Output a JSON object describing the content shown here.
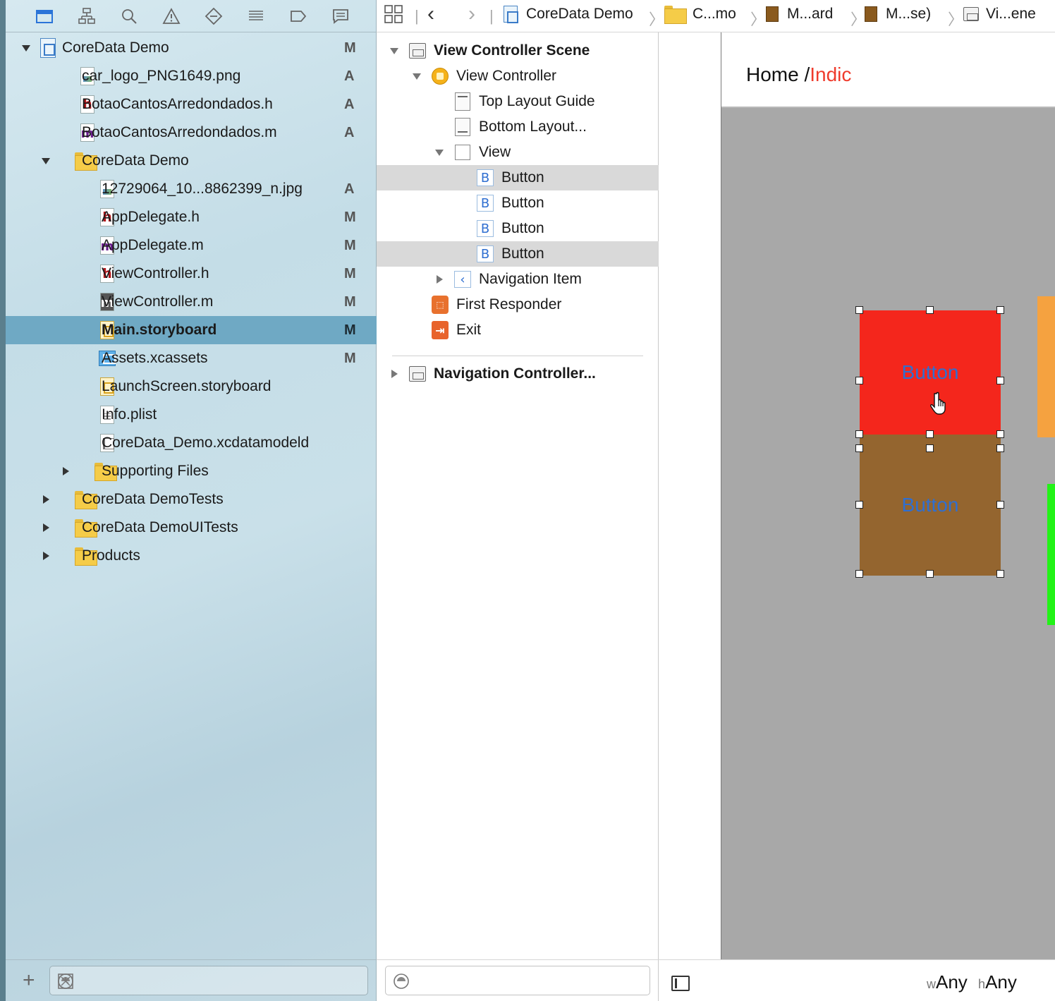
{
  "navigator": {
    "toolbar_icons": [
      "folder-icon",
      "hierarchy-icon",
      "search-icon",
      "warning-icon",
      "test-icon",
      "debug-icon",
      "breakpoint-icon",
      "report-icon"
    ],
    "items": [
      {
        "label": "CoreData Demo",
        "badge": "M",
        "icon": "project",
        "depth": 0,
        "disclosure": "open"
      },
      {
        "label": "car_logo_PNG1649.png",
        "badge": "A",
        "icon": "img",
        "depth": 1,
        "disclosure": ""
      },
      {
        "label": "BotaoCantosArredondados.h",
        "badge": "A",
        "icon": "h",
        "depth": 1,
        "disclosure": ""
      },
      {
        "label": "BotaoCantosArredondados.m",
        "badge": "A",
        "icon": "m",
        "depth": 1,
        "disclosure": ""
      },
      {
        "label": "CoreData Demo",
        "badge": "",
        "icon": "folder",
        "depth": 1,
        "disclosure": "open"
      },
      {
        "label": "12729064_10...8862399_n.jpg",
        "badge": "A",
        "icon": "img",
        "depth": 2,
        "disclosure": ""
      },
      {
        "label": "AppDelegate.h",
        "badge": "M",
        "icon": "h",
        "depth": 2,
        "disclosure": ""
      },
      {
        "label": "AppDelegate.m",
        "badge": "M",
        "icon": "m",
        "depth": 2,
        "disclosure": ""
      },
      {
        "label": "ViewController.h",
        "badge": "M",
        "icon": "h",
        "depth": 2,
        "disclosure": ""
      },
      {
        "label": "ViewController.m",
        "badge": "M",
        "icon": "mdark",
        "depth": 2,
        "disclosure": ""
      },
      {
        "label": "Main.storyboard",
        "badge": "M",
        "icon": "sb",
        "depth": 2,
        "disclosure": "",
        "selected": true
      },
      {
        "label": "Assets.xcassets",
        "badge": "M",
        "icon": "assets",
        "depth": 2,
        "disclosure": ""
      },
      {
        "label": "LaunchScreen.storyboard",
        "badge": "",
        "icon": "sb",
        "depth": 2,
        "disclosure": ""
      },
      {
        "label": "Info.plist",
        "badge": "",
        "icon": "plist",
        "depth": 2,
        "disclosure": ""
      },
      {
        "label": "CoreData_Demo.xcdatamodeld",
        "badge": "",
        "icon": "model",
        "depth": 2,
        "disclosure": ""
      },
      {
        "label": "Supporting Files",
        "badge": "",
        "icon": "folder",
        "depth": 2,
        "disclosure": "closed"
      },
      {
        "label": "CoreData DemoTests",
        "badge": "",
        "icon": "folder",
        "depth": 1,
        "disclosure": "closed"
      },
      {
        "label": "CoreData DemoUITests",
        "badge": "",
        "icon": "folder",
        "depth": 1,
        "disclosure": "closed"
      },
      {
        "label": "Products",
        "badge": "",
        "icon": "folder",
        "depth": 1,
        "disclosure": "closed"
      }
    ],
    "add_label": "+",
    "filter_placeholder": ""
  },
  "jump_bar": {
    "back": "‹",
    "forward": "›",
    "crumbs": [
      "CoreData Demo",
      "C...mo",
      "M...ard",
      "M...se)",
      "Vi...ene"
    ]
  },
  "outline": {
    "items": [
      {
        "label": "View Controller Scene",
        "icon": "scene",
        "depth": 0,
        "disclosure": "open",
        "bold": true
      },
      {
        "label": "View Controller",
        "icon": "vc",
        "depth": 1,
        "disclosure": "open"
      },
      {
        "label": "Top Layout Guide",
        "icon": "guide-top",
        "depth": 2,
        "disclosure": ""
      },
      {
        "label": "Bottom Layout...",
        "icon": "guide-bot",
        "depth": 2,
        "disclosure": ""
      },
      {
        "label": "View",
        "icon": "view",
        "depth": 2,
        "disclosure": "open"
      },
      {
        "label": "Button",
        "icon": "btn",
        "depth": 3,
        "disclosure": "",
        "highlight": true
      },
      {
        "label": "Button",
        "icon": "btn",
        "depth": 3,
        "disclosure": ""
      },
      {
        "label": "Button",
        "icon": "btn",
        "depth": 3,
        "disclosure": ""
      },
      {
        "label": "Button",
        "icon": "btn",
        "depth": 3,
        "disclosure": "",
        "highlight": true
      },
      {
        "label": "Navigation Item",
        "icon": "nav",
        "depth": 2,
        "disclosure": "closed"
      },
      {
        "label": "First Responder",
        "icon": "fr",
        "depth": 1,
        "disclosure": ""
      },
      {
        "label": "Exit",
        "icon": "exit",
        "depth": 1,
        "disclosure": ""
      }
    ],
    "second_scene": {
      "label": "Navigation Controller...",
      "disclosure": "closed"
    },
    "filter_placeholder": ""
  },
  "canvas": {
    "nav_title_prefix": "Home /",
    "nav_title_accent": "Indic",
    "button_red_label": "Button",
    "button_brown_label": "Button",
    "size_class": {
      "w_prefix": "w",
      "w_value": "Any",
      "h_prefix": "h",
      "h_value": "Any"
    }
  },
  "colors": {
    "selection": "#6fa9c4",
    "red_button": "#f4261c",
    "brown_button": "#94652f",
    "orange_button": "#f5a240",
    "green_button": "#22f317",
    "button_title": "#2f6fd1",
    "title_accent": "#ef3b2c"
  }
}
